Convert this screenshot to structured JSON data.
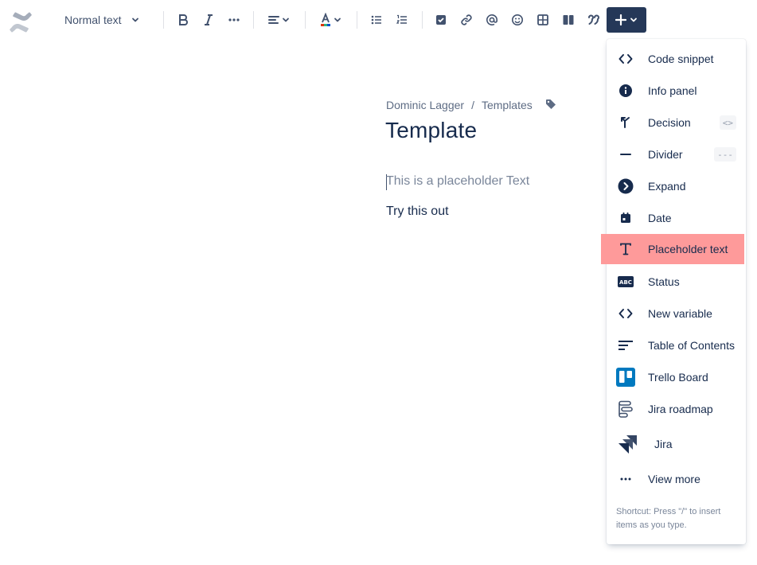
{
  "toolbar": {
    "text_style": "Normal text"
  },
  "page": {
    "breadcrumb": [
      "Dominic Lagger",
      "Templates"
    ],
    "breadcrumb_separator": "/",
    "title": "Template",
    "placeholder_text": "This is a placeholder Text",
    "body_text": "Try this out"
  },
  "insert_menu": {
    "items": [
      {
        "label": "Code snippet",
        "icon": "code-icon"
      },
      {
        "label": "Info panel",
        "icon": "info-icon"
      },
      {
        "label": "Decision",
        "icon": "decision-icon",
        "shortcut": "<>"
      },
      {
        "label": "Divider",
        "icon": "divider-icon",
        "shortcut": "---"
      },
      {
        "label": "Expand",
        "icon": "expand-icon"
      },
      {
        "label": "Date",
        "icon": "calendar-icon"
      },
      {
        "label": "Placeholder text",
        "icon": "placeholder-text-icon",
        "highlighted": true
      },
      {
        "label": "Status",
        "icon": "status-icon"
      },
      {
        "label": "New variable",
        "icon": "variable-icon"
      },
      {
        "label": "Table of Contents",
        "icon": "toc-icon"
      },
      {
        "label": "Trello Board",
        "icon": "trello-icon"
      },
      {
        "label": "Jira roadmap",
        "icon": "roadmap-icon"
      },
      {
        "label": "Jira",
        "icon": "jira-icon"
      },
      {
        "label": "View more",
        "icon": "more-icon"
      }
    ],
    "footer": "Shortcut: Press \"/\" to insert items as you type."
  },
  "colors": {
    "primary_text": "#172b4d",
    "secondary_text": "#5e6c84",
    "toolbar_icon": "#42526e",
    "insert_button": "#253858",
    "highlight": "#fe9a9a",
    "trello_blue": "#0079bf"
  }
}
